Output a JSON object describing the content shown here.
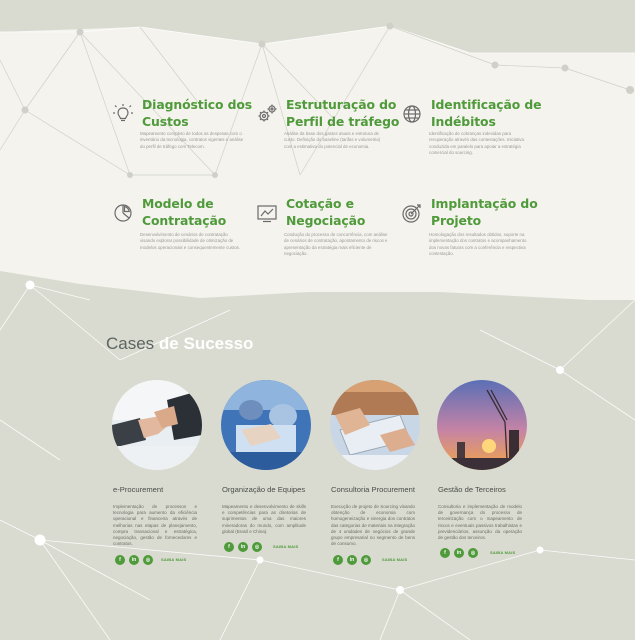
{
  "colors": {
    "accent": "#4f9a3a",
    "light_panel": "#f4f3ee",
    "page_bg": "#d9dbd0"
  },
  "services": [
    {
      "title": "Diagnóstico dos Custos",
      "icon": "lightbulb-icon",
      "desc": "Mapeamento completo de todos as despesas com o inventário da tecnologia, contratos vigentes e análise do perfil de tráfego com Telecom."
    },
    {
      "title": "Estruturação do Perfil de tráfego",
      "icon": "gears-icon",
      "desc": "Análise da base dos gastos atuais e estrutura de custo. Definição do baseline (tarifas e volumetria) com a estimativa do potencial de economia."
    },
    {
      "title": "Identificação de Indébitos",
      "icon": "globe-icon",
      "desc": "Identificação de cobranças indevidas para recuperação através das contestações. Iniciativa conduzida em paralelo para apoiar a estratégia comercial do sourcing."
    },
    {
      "title": "Modelo de Contratação",
      "icon": "pie-chart-icon",
      "desc": "Desenvolvimento de cenários de contratação visando explorar possibilidade de otimização de modelos operacionais e consequentemente custos."
    },
    {
      "title": "Cotação e Negociação",
      "icon": "line-chart-icon",
      "desc": "Condução do processo de concorrência, com análise de cenários de contratação, apontamento de riscos e apresentação da estratégia mais eficiente de negociação."
    },
    {
      "title": "Implantação do Projeto",
      "icon": "target-icon",
      "desc": "Homologação dos resultados obtidos, suporte na implementação dos contratos e acompanhamento dos novas faturas com a conferência e respectiva contestação."
    }
  ],
  "cases_heading": {
    "light": "Cases ",
    "bold": "de Sucesso"
  },
  "cases": [
    {
      "title": "e-Procurement",
      "desc": "Implementação de processos e tecnologia para aumento da eficiência operacional e financeira através de melhorias nas etapas de planejamento, compra transacional e estratégica, negociação, gestão de fornecedores e contratos."
    },
    {
      "title": "Organização de Equipes",
      "desc": "Mapeamento e desenvolvimento de skills e competências para as diretorias de suprimentos de uma das maiores mineradoras do mundo, com amplitude global (Brasil e China)."
    },
    {
      "title": "Consultoria Procurement",
      "desc": "Execução de projeto de Sourcing visando obtenção de economia com homogeneização e sinergia dos contratos das categorias de materiais na integração de 4 unidades de negócios de grande grupo empresarial no segmento de bens de consumo."
    },
    {
      "title": "Gestão de Terceiros",
      "desc": "Consultoria e implementação de modelo de governança do processo de terceirização com o mapeamento de riscos e eventuais passivos trabalhistas e previdenciários, assunção da operação de gestão dos terceiros."
    }
  ],
  "social": [
    "f",
    "in",
    "◎"
  ],
  "saiba_mais": "SAIBA MAIS"
}
